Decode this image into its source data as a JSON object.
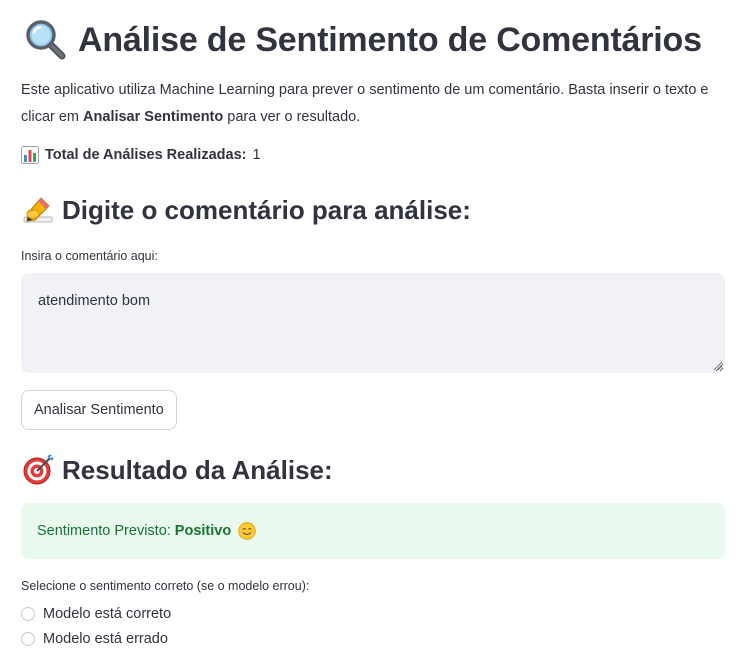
{
  "header": {
    "icon": "magnifying-glass-icon",
    "title": "Análise de Sentimento de Comentários"
  },
  "description": {
    "part1": "Este aplicativo utiliza Machine Learning para prever o sentimento de um comentário. Basta inserir o texto e clicar em ",
    "bold": "Analisar Sentimento",
    "part2": " para ver o resultado."
  },
  "stats": {
    "icon": "bar-chart-icon",
    "label": "Total de Análises Realizadas:",
    "value": "1"
  },
  "input_section": {
    "icon": "writing-hand-icon",
    "heading": "Digite o comentário para análise:",
    "field_label": "Insira o comentário aqui:",
    "field_value": "atendimento bom",
    "button_label": "Analisar Sentimento"
  },
  "result_section": {
    "icon": "target-icon",
    "heading": "Resultado da Análise:",
    "prefix": "Sentimento Previsto:",
    "sentiment": "Positivo",
    "sentiment_icon": "smiling-face-icon",
    "select_label": "Selecione o sentimento correto (se o modelo errou):",
    "options": [
      "Modelo está correto",
      "Modelo está errado"
    ]
  },
  "colors": {
    "text": "#31333f",
    "success_bg": "#e9f9ee",
    "success_text": "#177233",
    "input_bg": "#f0f2f6"
  }
}
